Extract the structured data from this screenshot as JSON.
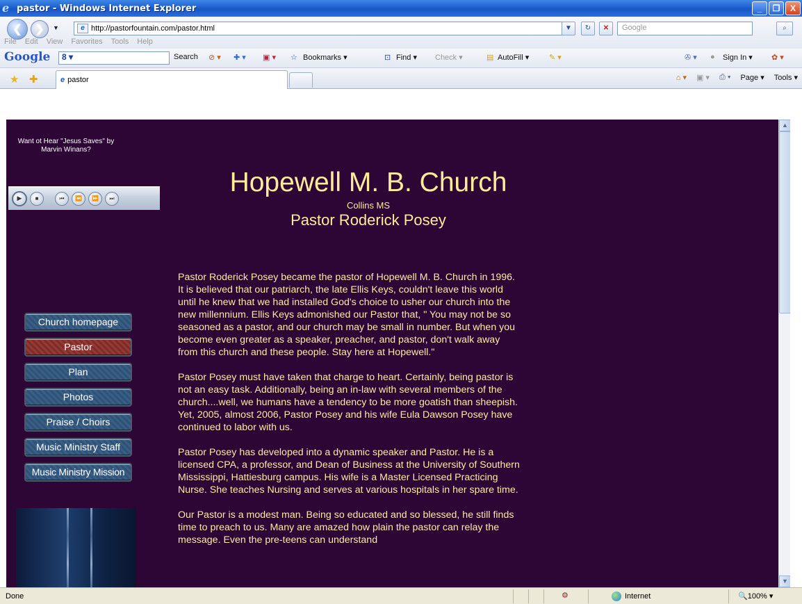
{
  "window": {
    "title": "pastor - Windows Internet Explorer",
    "minimize": "_",
    "maximize": "❐",
    "close": "X"
  },
  "address": {
    "url": "http://pastorfountain.com/pastor.html",
    "search_placeholder": "Google"
  },
  "menu": [
    "File",
    "Edit",
    "View",
    "Favorites",
    "Tools",
    "Help"
  ],
  "google_toolbar": {
    "logo": "Google",
    "box_value": "8 ▾",
    "search": "Search",
    "bookmarks": "Bookmarks ▾",
    "find": "Find ▾",
    "check": "Check ▾",
    "autofill": "AutoFill ▾",
    "sign_in": "Sign In ▾"
  },
  "tabs": {
    "active_tab": "pastor",
    "page_menu": "Page ▾",
    "tools_menu": "Tools ▾"
  },
  "page": {
    "promo": "Want ot Hear \"Jesus Saves\" by Marvin Winans?",
    "title": "Hopewell M. B. Church",
    "location": "Collins MS",
    "pastor": "Pastor Roderick Posey",
    "nav": [
      "Church homepage",
      "Pastor",
      "Plan",
      "Photos",
      "Praise / Choirs",
      "Music Ministry Staff",
      "Music Ministry Mission"
    ],
    "paragraphs": [
      "Pastor Roderick Posey became the pastor of Hopewell M. B. Church in 1996.  It is believed that our patriarch, the late Ellis Keys, couldn't leave this world until he knew that we had installed God's choice to usher our church into the new millennium.  Ellis Keys admonished our Pastor that, \" You may not be so seasoned as a pastor, and our church may be small in number.  But when you become  even greater as a speaker, preacher, and pastor, don't walk away from this church and these people.  Stay here at Hopewell.\"",
      "Pastor Posey must have taken that charge to heart. Certainly, being pastor is not an easy task. Additionally, being an in-law with several members of the church....well, we humans have a tendency to be more goatish than sheepish.  Yet, 2005, almost 2006, Pastor Posey and his wife Eula Dawson Posey have continued to labor with us.",
      "Pastor Posey has developed into a dynamic speaker and Pastor. He is a licensed CPA, a professor, and Dean of Business at the University of Southern Mississippi, Hattiesburg campus.  His wife is a Master Licensed Practicing Nurse. She teaches Nursing and serves at various hospitals in her spare time.",
      "Our Pastor is a modest man.  Being so educated and so blessed, he still finds time to preach to us.  Many are amazed how plain the pastor can relay the message.  Even the pre-teens can understand"
    ]
  },
  "status": {
    "text": "Done",
    "zone": "Internet",
    "zoom": "100%"
  },
  "colors": {
    "page_bg": "#2d0636",
    "heading": "#ffec9a",
    "nav_active": "#943a34",
    "nav_normal": "#3a5f86"
  }
}
